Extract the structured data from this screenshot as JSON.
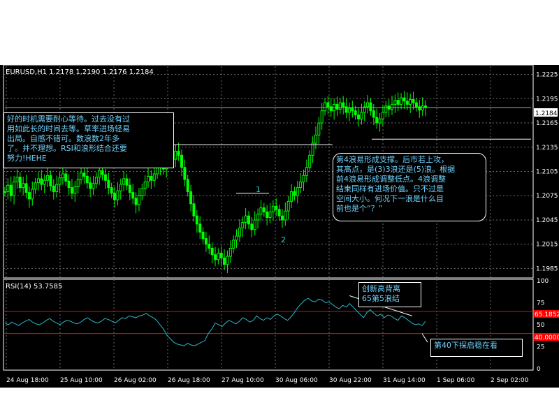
{
  "chart": {
    "header": "EURUSD,H1  1.2178 1.2190 1.2176 1.2184",
    "symbol": "EURUSD",
    "timeframe": "H1",
    "current_price_label": "1.2184",
    "price_ticks": [
      "1.2225",
      "1.2195",
      "1.2165",
      "1.2135",
      "1.2105",
      "1.2075",
      "1.2045",
      "1.2015",
      "1.1985"
    ],
    "time_ticks": [
      "24 Aug 18:00",
      "25 Aug 10:00",
      "26 Aug 02:00",
      "26 Aug 18:00",
      "27 Aug 10:00",
      "30 Aug 06:00",
      "30 Aug 22:00",
      "31 Aug 14:00",
      "1 Sep 06:00",
      "2 Sep 02:00"
    ],
    "wave_label_1": "1",
    "wave_label_2": "2"
  },
  "rsi": {
    "header": "RSI(14)  53.7585",
    "ticks": [
      "100",
      "75",
      "50",
      "25",
      "0"
    ],
    "level_high_label": "65.1852",
    "level_low_label": "40.0000"
  },
  "annotations": {
    "left_note": "好的时机需要耐心等待。过去没有过\n用如此长的时间去等。草率进场轻易\n出局。自感不错可。数浪数2年多\n了。并不理想。RSI和浪形结合还要\n努力!HEHE",
    "right_note": "第4浪易形成支撑。后市若上攻，\n其高点，是(3)3浪还是(5)浪。根据\n前4浪易形成调整低点。4浪调整\n结束同样有进场价值。只不过是\n空间大小。何况下一浪是什么目\n前也是个“？”",
    "rsi_top_note": "创新高背离\n65第5浪结",
    "rsi_bottom_note": "第40下探启稳在看"
  },
  "colors": {
    "background": "#000000",
    "candle": "#00ff00",
    "grid": "#6b6b6b",
    "text": "#ffffff",
    "annotation": "#6fd3ff",
    "level_line": "#ff0000",
    "rsi_line": "#2bb7c8"
  },
  "chart_data": {
    "type": "candlestick",
    "series": [
      {
        "name": "EURUSD",
        "values": [
          1.208,
          1.2088,
          1.2075,
          1.2092,
          1.2098,
          1.2085,
          1.209,
          1.2079,
          1.2071,
          1.2083,
          1.2091,
          1.2096,
          1.2089,
          1.2094,
          1.21,
          1.2087,
          1.208,
          1.2089,
          1.2097,
          1.2102,
          1.2093,
          1.2085,
          1.2078,
          1.2086,
          1.2095,
          1.2103,
          1.2099,
          1.2091,
          1.2084,
          1.209,
          1.2098,
          1.2106,
          1.2101,
          1.2094,
          1.2085,
          1.2078,
          1.207,
          1.2081,
          1.2089,
          1.2096,
          1.2088,
          1.2079,
          1.2072,
          1.2064,
          1.2075,
          1.2084,
          1.2092,
          1.2099,
          1.2094,
          1.2102,
          1.211,
          1.2115,
          1.2108,
          1.2118,
          1.2125,
          1.212,
          1.213,
          1.2125,
          1.211,
          1.2095,
          1.208,
          1.2065,
          1.205,
          1.204,
          1.203,
          1.2022,
          1.2015,
          1.201,
          1.2002,
          1.1996,
          1.2004,
          1.1998,
          1.199,
          1.2,
          1.201,
          1.202,
          1.2025,
          1.2035,
          1.2042,
          1.205,
          1.204,
          1.2033,
          1.2045,
          1.2052,
          1.206,
          1.2055,
          1.2048,
          1.2055,
          1.2062,
          1.2058,
          1.205,
          1.2045,
          1.2056,
          1.2068,
          1.208,
          1.2075,
          1.2085,
          1.2092,
          1.21,
          1.211,
          1.2125,
          1.214,
          1.215,
          1.2165,
          1.218,
          1.219,
          1.2185,
          1.218,
          1.2188,
          1.2182,
          1.219,
          1.2185,
          1.2178,
          1.2183,
          1.218,
          1.2175,
          1.217,
          1.2178,
          1.2185,
          1.219,
          1.218,
          1.2172,
          1.2165,
          1.217,
          1.2178,
          1.2186,
          1.2182,
          1.2188,
          1.2193,
          1.2188,
          1.2196,
          1.2192,
          1.2188,
          1.2194,
          1.219,
          1.2185,
          1.2181,
          1.2186,
          1.2184
        ]
      },
      {
        "name": "RSI(14)",
        "values": [
          52,
          50,
          53,
          51,
          49,
          52,
          54,
          56,
          53,
          51,
          50,
          52,
          55,
          57,
          54,
          52,
          50,
          53,
          55,
          54,
          52,
          51,
          53,
          56,
          58,
          55,
          53,
          52,
          54,
          57,
          56,
          54,
          52,
          55,
          58,
          57,
          60,
          59,
          58,
          60,
          61,
          63,
          60,
          58,
          55,
          50,
          45,
          38,
          34,
          30,
          28,
          27,
          26,
          29,
          27,
          26,
          28,
          30,
          32,
          40,
          45,
          52,
          50,
          48,
          52,
          55,
          53,
          51,
          54,
          58,
          56,
          53,
          55,
          60,
          57,
          55,
          58,
          56,
          60,
          62,
          60,
          57,
          55,
          59,
          64,
          70,
          74,
          78,
          80,
          77,
          76,
          79,
          78,
          75,
          76,
          73,
          70,
          68,
          72,
          70,
          74,
          70,
          66,
          62,
          58,
          64,
          67,
          63,
          60,
          62,
          58,
          61,
          60,
          57,
          55,
          60,
          58,
          55,
          52,
          50,
          51,
          49,
          54
        ]
      }
    ],
    "ylim": [
      1.1975,
      1.2235
    ],
    "rsi_levels": [
      40,
      65.1852
    ],
    "rsi_ylim": [
      0,
      100
    ],
    "grid": true
  }
}
